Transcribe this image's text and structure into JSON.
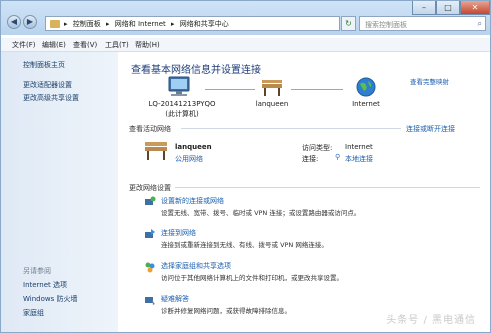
{
  "window": {
    "minimize": "–",
    "maximize": "□",
    "close": "✕"
  },
  "address": {
    "crumbs": [
      "▸",
      "控制面板",
      "▸",
      "网络和 Internet",
      "▸",
      "网络和共享中心"
    ],
    "search_placeholder": "搜索控制面板"
  },
  "menu": [
    "文件(F)",
    "编辑(E)",
    "查看(V)",
    "工具(T)",
    "帮助(H)"
  ],
  "sidebar": {
    "home": "控制面板主页",
    "items": [
      "更改适配器设置",
      "更改高级共享设置"
    ],
    "see_also_title": "另请参阅",
    "see_also": [
      "Internet 选项",
      "Windows 防火墙",
      "家庭组"
    ]
  },
  "main": {
    "title": "查看基本网络信息并设置连接",
    "full_map": "查看完整映射",
    "nodes": [
      {
        "name": "LQ-20141213PYQO",
        "sub": "(此计算机)"
      },
      {
        "name": "lanqueen",
        "sub": ""
      },
      {
        "name": "Internet",
        "sub": ""
      }
    ],
    "active_title": "查看活动网络",
    "connect_link": "连接或断开连接",
    "network": {
      "name": "lanqueen",
      "type": "公用网络",
      "access_label": "访问类型:",
      "access_value": "Internet",
      "conn_label": "连接:",
      "conn_value": "本地连接"
    },
    "change_title": "更改网络设置",
    "tasks": [
      {
        "title": "设置新的连接或网络",
        "desc": "设置无线、宽带、拨号、临时或 VPN 连接；或设置路由器或访问点。",
        "icon": "new-connection-icon"
      },
      {
        "title": "连接到网络",
        "desc": "连接到或重新连接到无线、有线、拨号或 VPN 网络连接。",
        "icon": "connect-network-icon"
      },
      {
        "title": "选择家庭组和共享选项",
        "desc": "访问位于其他网络计算机上的文件和打印机，或更改共享设置。",
        "icon": "homegroup-icon"
      },
      {
        "title": "疑难解答",
        "desc": "诊断并修复网络问题，或获得故障排除信息。",
        "icon": "troubleshoot-icon"
      }
    ],
    "watermark": "头条号 / 黑电通信"
  }
}
